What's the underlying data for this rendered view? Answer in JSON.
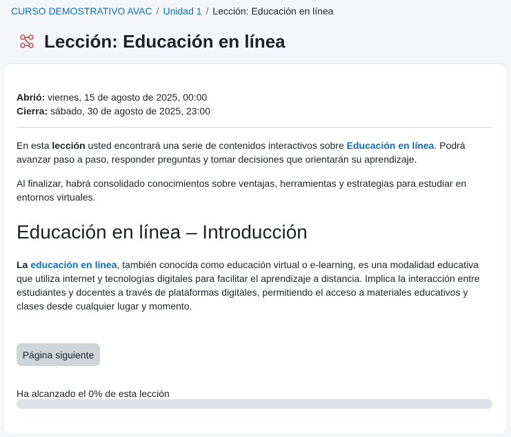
{
  "breadcrumb": {
    "course": "CURSO DEMOSTRATIVO AVAC",
    "sep1": "/",
    "unit": "Unidad 1",
    "sep2": "/",
    "current": "Lección: Educación en línea"
  },
  "header": {
    "icon": "lesson-network-icon",
    "title": "Lección: Educación en línea"
  },
  "dates": {
    "opened_label": "Abrió:",
    "opened_value": " viernes, 15 de agosto de 2025, 00:00",
    "closes_label": "Cierra:",
    "closes_value": " sábado, 30 de agosto de 2025, 23:00"
  },
  "intro": {
    "p1_a": "En esta ",
    "p1_bold": "lección",
    "p1_b": " usted encontrará una serie de contenidos interactivos sobre ",
    "p1_link": "Educación en línea",
    "p1_c": ". Podrá avanzar paso a paso, responder preguntas y tomar decisiones que orientarán su aprendizaje.",
    "p2": "Al finalizar, habrá consolidado conocimientos sobre ventajas, herramientas y estrategias para estudiar en entornos virtuales."
  },
  "content": {
    "heading": "Educación en línea – Introducción",
    "p_bold": "La ",
    "p_link": "educación en línea",
    "p_rest": ", también conocida como educación virtual o e-learning, es una modalidad educativa que utiliza internet y tecnologías digitales para facilitar el aprendizaje a distancia. Implica la interacción entre estudiantes y docentes a través de plataformas digitales, permitiendo el acceso a materiales educativos y clases desde cualquier lugar y momento."
  },
  "actions": {
    "next_label": "Página siguiente"
  },
  "progress": {
    "label": "Ha alcanzado el 0% de esta lección",
    "percent": 0
  },
  "colors": {
    "link": "#0f6cbf",
    "icon_accent": "#c0504d",
    "button_bg": "#ced4da",
    "progress_track": "#dee2e6"
  }
}
